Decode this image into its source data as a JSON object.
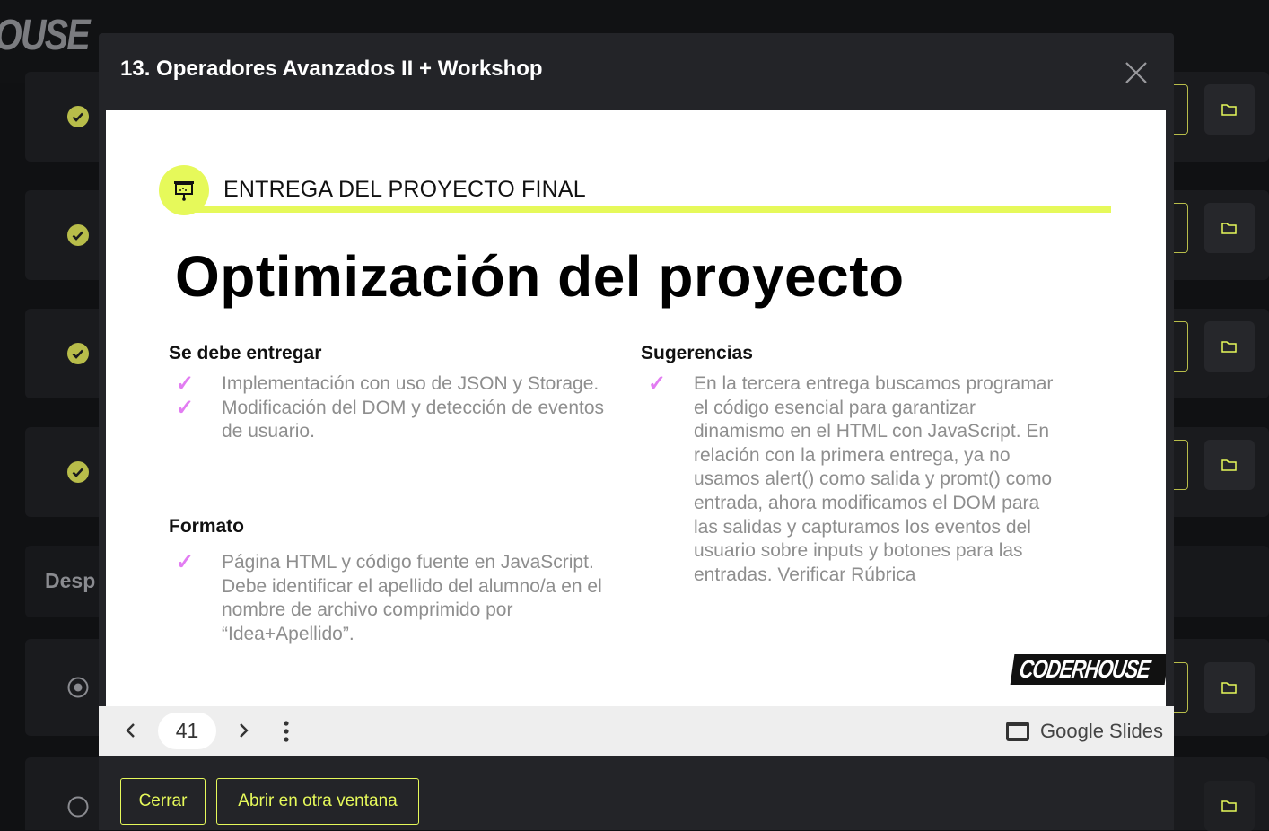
{
  "background": {
    "logo_text": "OUSE",
    "section_title": "Desp",
    "rows": [
      {
        "status": "completed"
      },
      {
        "status": "completed"
      },
      {
        "status": "completed"
      },
      {
        "status": "completed"
      },
      {
        "status": "in-progress"
      },
      {
        "status": "pending"
      }
    ],
    "icons": {
      "completed": "check-circle-icon",
      "in_progress": "radio-dot-icon",
      "pending": "empty-circle-icon",
      "folder": "folder-icon"
    }
  },
  "modal": {
    "title": "13. Operadores Avanzados II + Workshop",
    "close_icon": "close-icon"
  },
  "slide": {
    "section_label": "ENTREGA DEL PROYECTO FINAL",
    "title": "Optimización del proyecto",
    "left": {
      "heading1": "Se debe entregar",
      "items1": [
        "Implementación con uso de JSON y Storage.",
        "Modificación del DOM y detección de eventos de usuario."
      ],
      "heading2": "Formato",
      "items2": [
        "Página HTML y  código fuente en JavaScript. Debe identificar el apellido del alumno/a en el nombre de archivo comprimido por “Idea+Apellido”."
      ]
    },
    "right": {
      "heading": "Sugerencias",
      "items": [
        "En la tercera entrega buscamos programar el código esencial para garantizar dinamismo en el HTML con JavaScript. En relación con la primera entrega, ya no usamos alert() como salida y promt() como entrada, ahora modificamos el DOM para las salidas y capturamos los eventos del usuario sobre inputs y botones para las entradas. Verificar Rúbrica"
      ]
    },
    "check_mark": "✓",
    "logo_text": "CODERHOUSE"
  },
  "slides_bar": {
    "page_number": "41",
    "brand_label": "Google Slides"
  },
  "footer": {
    "close_label": "Cerrar",
    "open_label": "Abrir en otra ventana"
  },
  "colors": {
    "accent": "#e6f95a",
    "check": "#e27cf2",
    "modal_bg": "#232428",
    "status_green": "#b8bd4a"
  }
}
